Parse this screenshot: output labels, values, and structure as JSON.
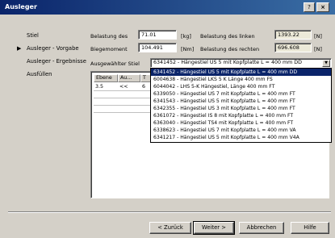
{
  "window": {
    "title": "Ausleger",
    "help_label": "?",
    "close_label": "×"
  },
  "nav": {
    "items": [
      {
        "label": "Stiel"
      },
      {
        "label": "Ausleger - Vorgabe",
        "active": true
      },
      {
        "label": "Ausleger - Ergebnisse"
      },
      {
        "label": "Ausfüllen"
      }
    ],
    "arrow": "▶"
  },
  "form": {
    "belastung_des_label": "Belastung des",
    "belastung_des_value": "71.01",
    "belastung_des_unit": "[kg]",
    "biegemoment_label": "Biegemoment",
    "biegemoment_value": "104.491",
    "biegemoment_unit": "[Nm]",
    "belastung_links_label": "Belastung des linken",
    "belastung_links_value": "1393.22",
    "belastung_links_unit": "[N]",
    "belastung_rechts_label": "Belastung des rechten",
    "belastung_rechts_value": "696.608",
    "belastung_rechts_unit": "[N]",
    "selected_stiel_label": "Ausgewählter Stiel",
    "selected_stiel_value": "6341452 - Hängestiel US 5 mit Kopfplatte L = 400 mm DD"
  },
  "dropdown_options": [
    "6341452 - Hängestiel US 5 mit Kopfplatte L = 400 mm DD",
    "6004638 - Hängestiel LKS 5 K Länge 400 mm FS",
    "6044042 - LHS 5-K Hängestiel, Länge 400 mm FT",
    "6339050 - Hängestiel US 7 mit Kopfplatte L = 400 mm FT",
    "6341543 - Hängestiel US 5 mit Kopfplatte L = 400 mm FT",
    "6342355 - Hängestiel US 3 mit Kopfplatte L = 400 mm FT",
    "6361072 - Hängestiel IS 8 mit Kopfplatte L = 400 mm FT",
    "6363040 - Hängestiel TS4 mit Kopfplatte L = 400 mm FT",
    "6338623 - Hängestiel US 7 mit Kopfplatte L = 400 mm VA",
    "6341217 - Hängestiel US 5 mit Kopfplatte L = 400 mm V4A"
  ],
  "grid": {
    "headers": [
      "Ebene",
      "Au...",
      "T"
    ],
    "row": {
      "ebene": "3.5",
      "au": "<<",
      "t": "6"
    }
  },
  "buttons": {
    "back": "< Zurück",
    "next": "Weiter >",
    "cancel": "Abbrechen",
    "help": "Hilfe"
  }
}
